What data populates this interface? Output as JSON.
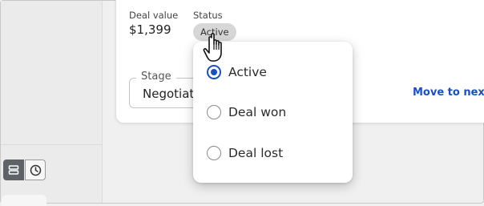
{
  "deal": {
    "value_label": "Deal value",
    "value": "$1,399",
    "status_label": "Status",
    "status_chip": "Active",
    "stage_label": "Stage",
    "stage_value": "Negotiation",
    "move_link": "Move to next"
  },
  "status_menu": {
    "options": [
      {
        "label": "Active",
        "selected": true
      },
      {
        "label": "Deal won",
        "selected": false
      },
      {
        "label": "Deal lost",
        "selected": false
      }
    ]
  },
  "view_toggle": {
    "list_icon": "list-icon",
    "clock_icon": "clock-icon",
    "active": "list"
  },
  "colors": {
    "accent": "#1a4fc4",
    "chip_bg": "#d7d7d7",
    "toggle_active": "#5f6368"
  }
}
